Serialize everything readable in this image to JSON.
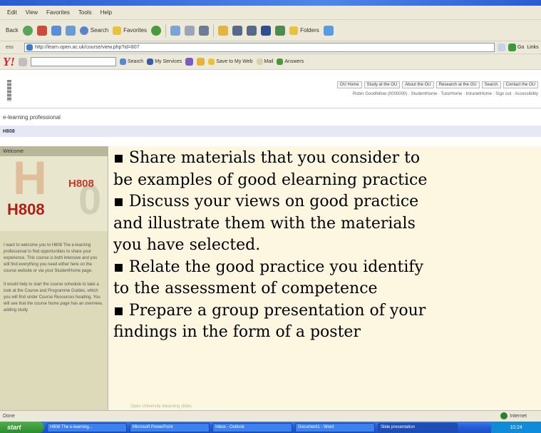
{
  "menu": [
    "Edit",
    "View",
    "Favorites",
    "Tools",
    "Help"
  ],
  "toolbar": {
    "back": "Back",
    "search": "Search",
    "favorites": "Favorites",
    "folders": "Folders"
  },
  "address": {
    "label": "ess",
    "url": "http://learn.open.ac.uk/course/view.php?id=807",
    "go": "Go",
    "links": "Links"
  },
  "yahoo_bar": {
    "search": "Search",
    "bookmarks": "My Services",
    "mail": "Mail",
    "answers": "Answers",
    "share": "Save to My Web"
  },
  "site": {
    "nav": [
      "OU Home",
      "Study at the OU",
      "About the OU",
      "Research at the OU",
      "Search",
      "Contact the OU"
    ],
    "user_line": "Robin Goodfellow (0000000) · StudentHome · TutorHome · IntranetHome · Sign out · Accessibility"
  },
  "breadcrumb": "e-learning professional",
  "breadcrumb2": "H808",
  "sidebar": {
    "heading": "Welcome",
    "course_badge_small": "H808",
    "course_badge_large": "H808",
    "intro": "I want to welcome you to H808 The e-learning professional to find opportunities to share your experience. This course is both intensive and you will find everything you need either here on the course website or via your StudentHome page.",
    "note": "It would help to start the course schedule to take a look at the Course and Programme Guides, which you will find under Course Resources heading. You will see that the course home page has an overview, adding study"
  },
  "slide": {
    "lines": [
      "▪ Share materials that you consider to",
      "be examples of good elearning practice",
      "▪ Discuss your views on good practice",
      "and illustrate them with the materials",
      "you have selected.",
      "▪ Relate the good practice you identify",
      "to the assessment of competence",
      "▪ Prepare a group presentation of your",
      "findings in the form of a poster"
    ],
    "faint": "Open University elearning slides"
  },
  "status": {
    "text": "Done",
    "zone": "Internet"
  },
  "taskbar": {
    "start": "start",
    "tasks": [
      "H808 The e-learning...",
      "Microsoft PowerPoint",
      "Inbox - Outlook",
      "Document1 - Word",
      "Slide presentation"
    ],
    "clock": "10:24"
  }
}
